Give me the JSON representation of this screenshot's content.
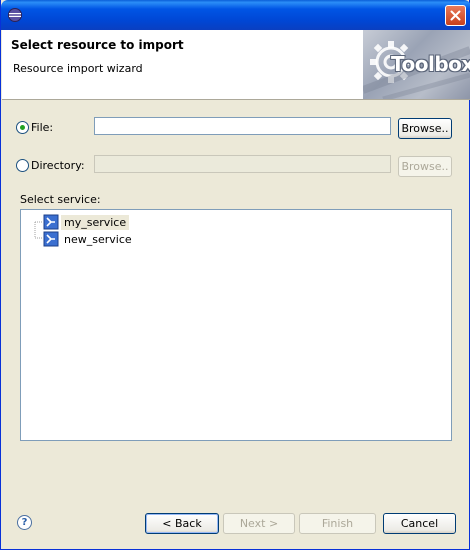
{
  "banner": {
    "title": "Select resource to import",
    "description": "Resource import wizard",
    "logo_text": "Toolbox"
  },
  "file_row": {
    "label": "File:",
    "value": "",
    "browse": "Browse..",
    "selected": true
  },
  "directory_row": {
    "label": "Directory:",
    "value": "",
    "browse": "Browse..",
    "selected": false
  },
  "service_section": {
    "label": "Select service:",
    "items": [
      {
        "label": "my_service",
        "selected": true
      },
      {
        "label": "new_service",
        "selected": false
      }
    ]
  },
  "footer": {
    "back": "< Back",
    "next": "Next >",
    "finish": "Finish",
    "cancel": "Cancel",
    "help_icon": "question-mark"
  },
  "colors": {
    "titlebar": "#0055e5",
    "dialog_bg": "#ece9d8",
    "radio_dot": "#21a121"
  }
}
